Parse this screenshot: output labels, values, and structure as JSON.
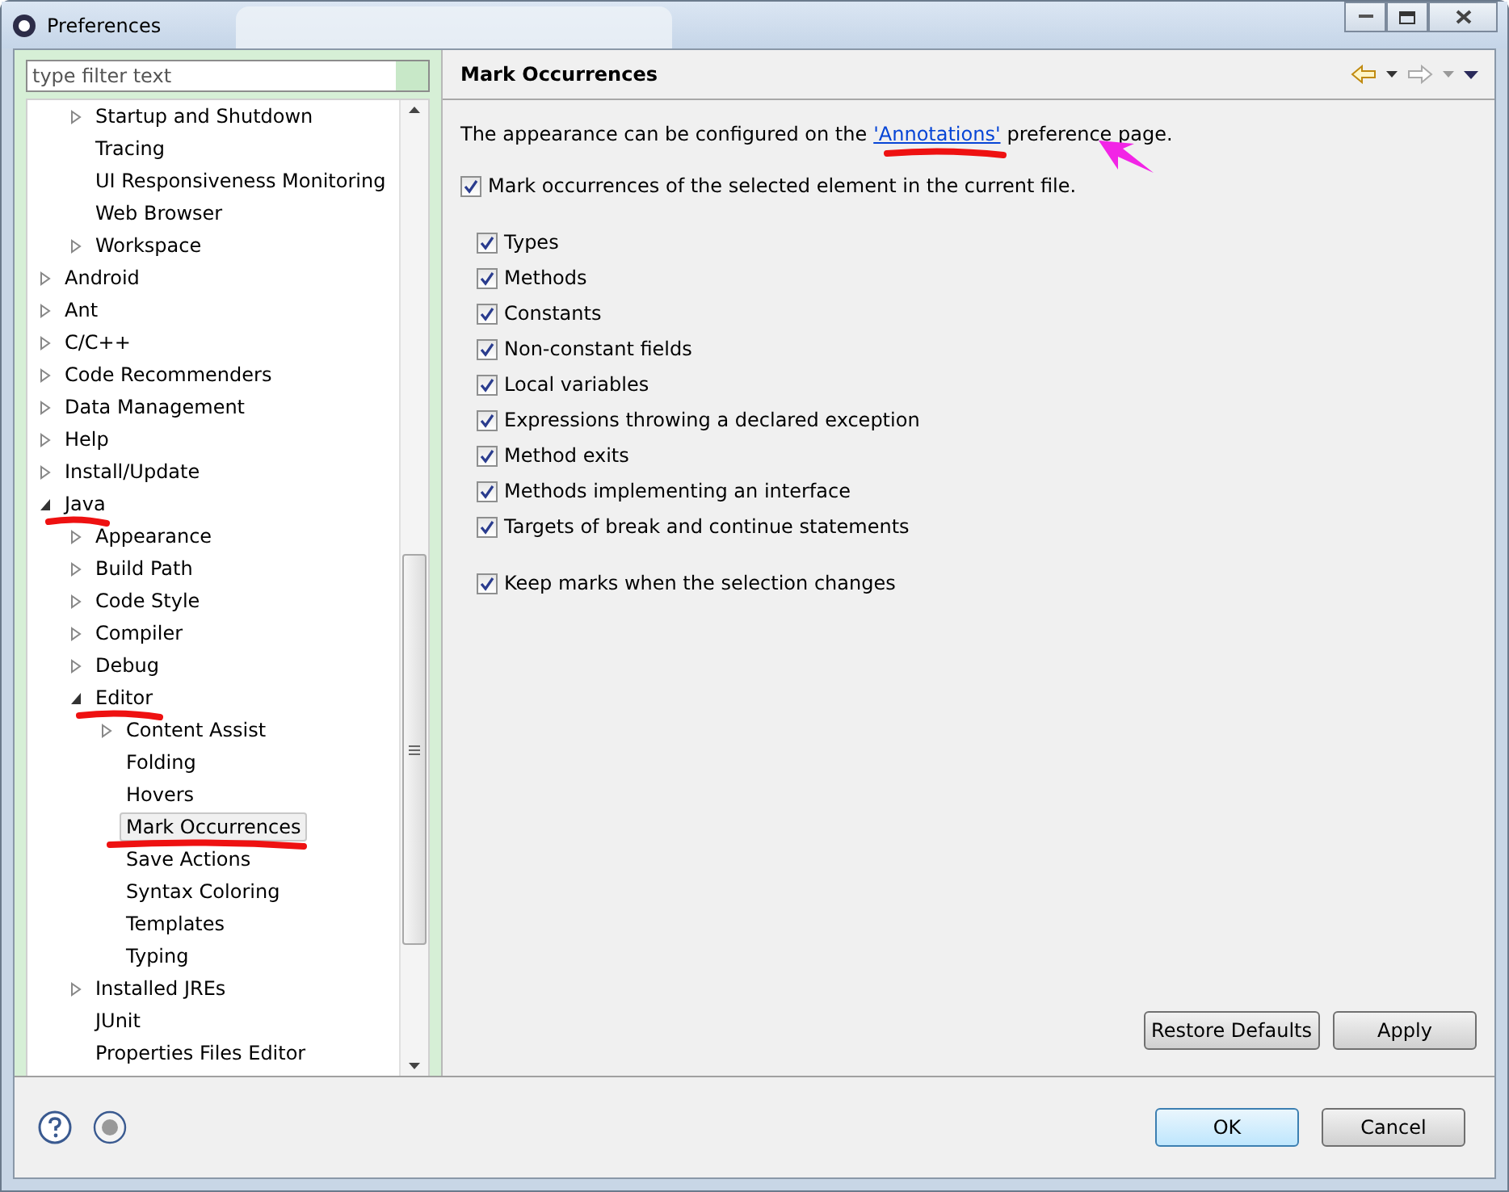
{
  "window": {
    "title": "Preferences"
  },
  "filter": {
    "placeholder": "type filter text"
  },
  "tree": [
    {
      "children": [
        {
          "label": "Startup and Shutdown",
          "expandable": true,
          "expanded": false,
          "selected": false,
          "marked": false
        },
        {
          "label": "Tracing",
          "expandable": false,
          "selected": false,
          "marked": false
        },
        {
          "label": "UI Responsiveness Monitoring",
          "expandable": false,
          "selected": false,
          "marked": false
        },
        {
          "label": "Web Browser",
          "expandable": false,
          "selected": false,
          "marked": false
        },
        {
          "label": "Workspace",
          "expandable": true,
          "expanded": false,
          "selected": false,
          "marked": false
        }
      ]
    },
    {
      "label": "Android",
      "expandable": true,
      "expanded": false,
      "selected": false,
      "marked": false
    },
    {
      "label": "Ant",
      "expandable": true,
      "expanded": false,
      "selected": false,
      "marked": false
    },
    {
      "label": "C/C++",
      "expandable": true,
      "expanded": false,
      "selected": false,
      "marked": false
    },
    {
      "label": "Code Recommenders",
      "expandable": true,
      "expanded": false,
      "selected": false,
      "marked": false
    },
    {
      "label": "Data Management",
      "expandable": true,
      "expanded": false,
      "selected": false,
      "marked": false
    },
    {
      "label": "Help",
      "expandable": true,
      "expanded": false,
      "selected": false,
      "marked": false
    },
    {
      "label": "Install/Update",
      "expandable": true,
      "expanded": false,
      "selected": false,
      "marked": false
    },
    {
      "label": "Java",
      "expandable": true,
      "expanded": true,
      "selected": false,
      "marked": true,
      "children": [
        {
          "label": "Appearance",
          "expandable": true,
          "expanded": false,
          "selected": false,
          "marked": false
        },
        {
          "label": "Build Path",
          "expandable": true,
          "expanded": false,
          "selected": false,
          "marked": false
        },
        {
          "label": "Code Style",
          "expandable": true,
          "expanded": false,
          "selected": false,
          "marked": false
        },
        {
          "label": "Compiler",
          "expandable": true,
          "expanded": false,
          "selected": false,
          "marked": false
        },
        {
          "label": "Debug",
          "expandable": true,
          "expanded": false,
          "selected": false,
          "marked": false
        },
        {
          "label": "Editor",
          "expandable": true,
          "expanded": true,
          "selected": false,
          "marked": true,
          "children": [
            {
              "label": "Content Assist",
              "expandable": true,
              "expanded": false,
              "selected": false,
              "marked": false
            },
            {
              "label": "Folding",
              "expandable": false,
              "selected": false,
              "marked": false
            },
            {
              "label": "Hovers",
              "expandable": false,
              "selected": false,
              "marked": false
            },
            {
              "label": "Mark Occurrences",
              "expandable": false,
              "selected": true,
              "marked": true
            },
            {
              "label": "Save Actions",
              "expandable": false,
              "selected": false,
              "marked": false
            },
            {
              "label": "Syntax Coloring",
              "expandable": false,
              "selected": false,
              "marked": false
            },
            {
              "label": "Templates",
              "expandable": false,
              "selected": false,
              "marked": false
            },
            {
              "label": "Typing",
              "expandable": false,
              "selected": false,
              "marked": false
            }
          ]
        },
        {
          "label": "Installed JREs",
          "expandable": true,
          "expanded": false,
          "selected": false,
          "marked": false
        },
        {
          "label": "JUnit",
          "expandable": false,
          "selected": false,
          "marked": false
        },
        {
          "label": "Properties Files Editor",
          "expandable": false,
          "selected": false,
          "marked": false
        }
      ]
    }
  ],
  "page": {
    "title": "Mark Occurrences",
    "intro_before": "The appearance can be configured on the",
    "link": {
      "label": "'Annotations'",
      "marked": true,
      "arrow": true
    },
    "intro_after": "preference page.",
    "main_option": {
      "label": "Mark occurrences of the selected element in the current file.",
      "checked": true
    },
    "options": [
      {
        "label": "Types",
        "checked": true
      },
      {
        "label": "Methods",
        "checked": true
      },
      {
        "label": "Constants",
        "checked": true
      },
      {
        "label": "Non-constant fields",
        "checked": true
      },
      {
        "label": "Local variables",
        "checked": true
      },
      {
        "label": "Expressions throwing a declared exception",
        "checked": true
      },
      {
        "label": "Method exits",
        "checked": true
      },
      {
        "label": "Methods implementing an interface",
        "checked": true
      },
      {
        "label": "Targets of break and continue statements",
        "checked": true
      }
    ],
    "keep_option": {
      "label": "Keep marks when the selection changes",
      "checked": true
    },
    "buttons": [
      "Restore Defaults",
      "Apply"
    ]
  },
  "dialog_buttons": [
    {
      "label": "OK",
      "default": true
    },
    {
      "label": "Cancel",
      "default": false
    }
  ]
}
